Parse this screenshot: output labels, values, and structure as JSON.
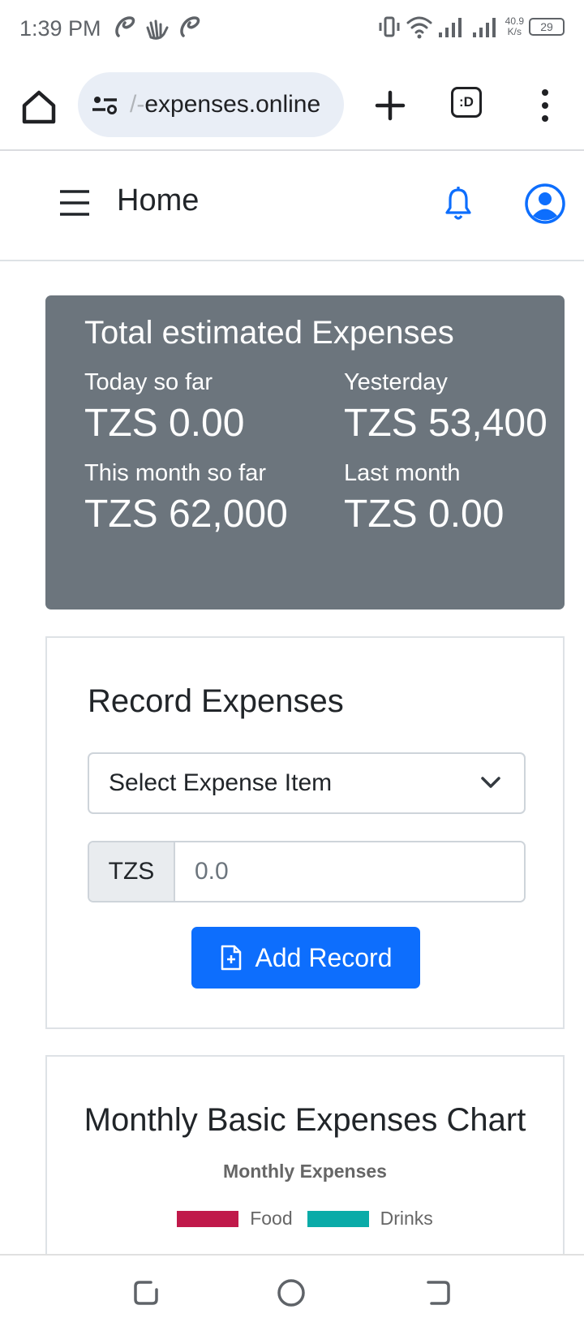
{
  "status_bar": {
    "time": "1:39 PM",
    "net_speed_value": "40.9",
    "net_speed_unit": "K/s",
    "battery": "29"
  },
  "browser": {
    "url_faded": "/-",
    "url": "expenses.online",
    "tabs_label": ":D"
  },
  "navbar": {
    "title": "Home"
  },
  "summary": {
    "heading": "Total estimated Expenses",
    "items": [
      {
        "label": "Today so far",
        "value": "TZS 0.00"
      },
      {
        "label": "Yesterday",
        "value": "TZS 53,400"
      },
      {
        "label": "This month so far",
        "value": "TZS 62,000"
      },
      {
        "label": "Last month",
        "value": "TZS 0.00"
      }
    ]
  },
  "record": {
    "heading": "Record Expenses",
    "select_value": "Select Expense Item",
    "currency_prefix": "TZS",
    "amount_placeholder": "0.0",
    "button_label": "Add Record"
  },
  "chart_card": {
    "heading": "Monthly Basic Expenses Chart"
  },
  "chart_data": {
    "type": "bar",
    "title": "Monthly Expenses",
    "series": [
      {
        "name": "Food",
        "color": "#c0194a"
      },
      {
        "name": "Drinks",
        "color": "#0aaba8"
      }
    ],
    "legend_position": "top"
  },
  "colors": {
    "primary": "#0d6efd",
    "summary_bg": "#6c757d"
  }
}
